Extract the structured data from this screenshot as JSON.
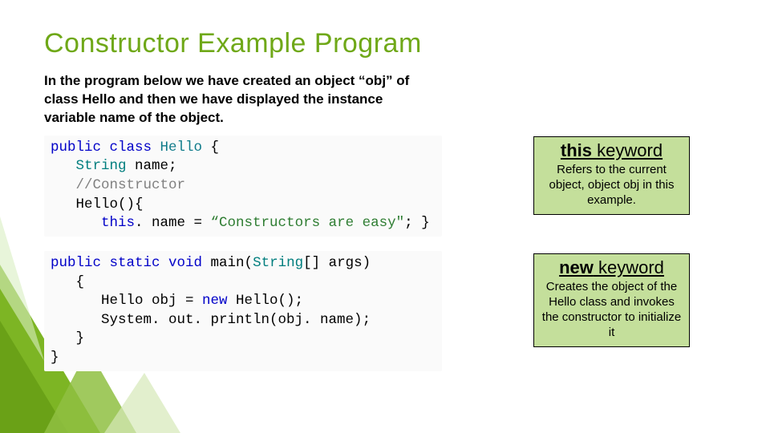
{
  "title": "Constructor Example Program",
  "intro": "In the program below we have created an object “obj” of class Hello and then we have displayed the instance variable name of the object.",
  "code1": {
    "l1a": "public",
    "l1b": " class",
    "l1c": " Hello",
    "l1d": " {",
    "l2a": "   ",
    "l2b": "String",
    "l2c": " name;",
    "l3a": "   ",
    "l3b": "//Constructor",
    "l4a": "   Hello(){",
    "l5a": "      ",
    "l5b": "this",
    "l5c": ". name = ",
    "l5d": "“Constructors are easy\"",
    "l5e": "; }"
  },
  "code2": {
    "l1a": "public",
    "l1b": " static",
    "l1c": " void",
    "l1d": " main(",
    "l1e": "String",
    "l1f": "[] args)",
    "l2a": "   {",
    "l3a": "      Hello obj = ",
    "l3b": "new",
    "l3c": " Hello();",
    "l4a": "      System. out. println(obj. name);",
    "l5a": "   }",
    "l6a": "}"
  },
  "callouts": [
    {
      "title_kw": "this",
      "title_rest": " keyword",
      "body": "Refers to the current object, object obj in this example."
    },
    {
      "title_kw": "new",
      "title_rest": " keyword",
      "body": "Creates the object of the Hello class and invokes the constructor to initialize it"
    }
  ]
}
